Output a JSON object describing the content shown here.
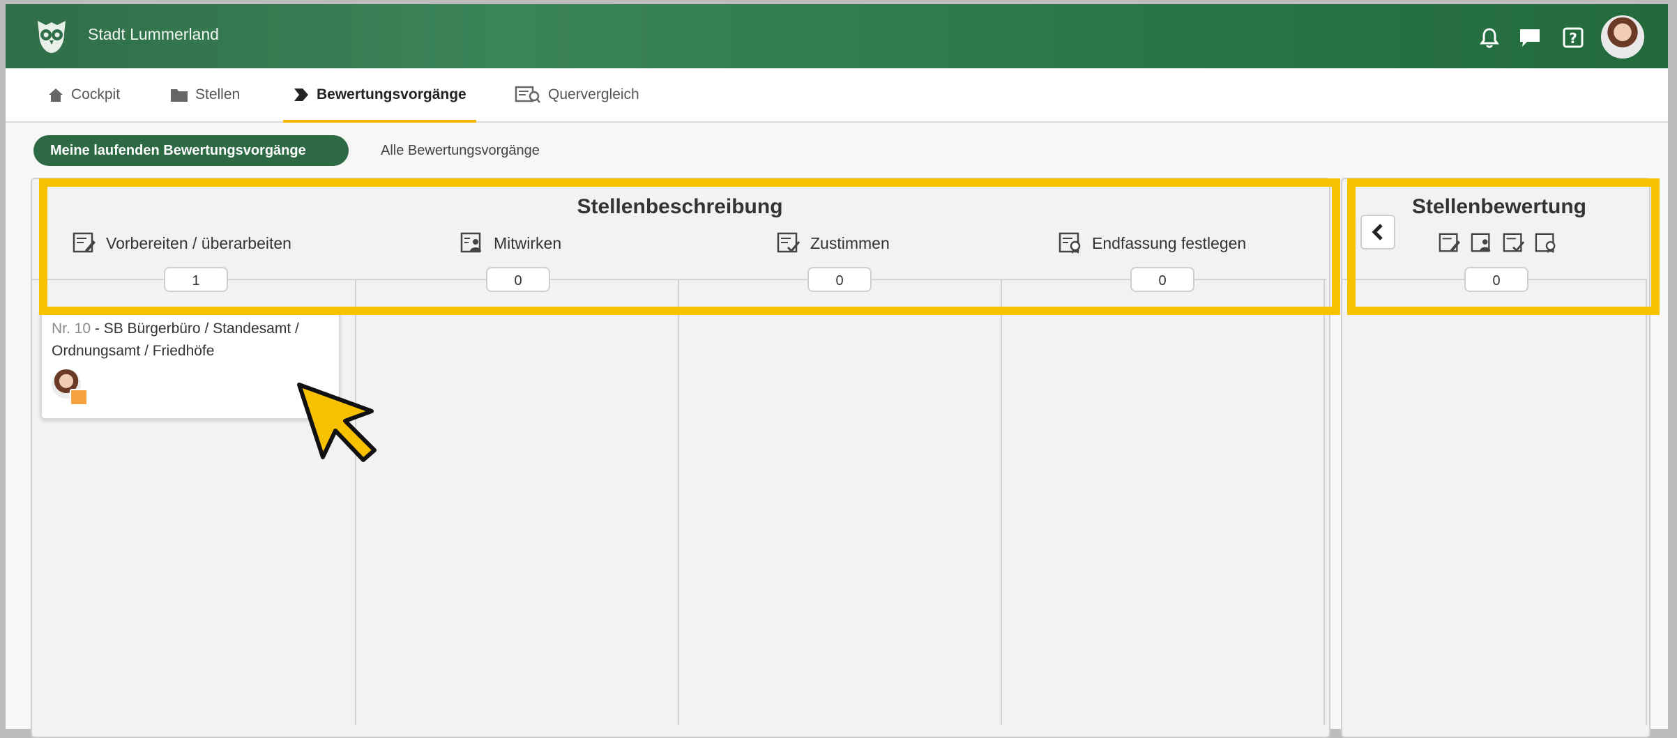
{
  "header": {
    "org_name": "Stadt Lummerland",
    "icons": [
      "owl-logo-icon",
      "bell-icon",
      "chat-icon",
      "help-icon",
      "user-avatar"
    ]
  },
  "tabs": [
    {
      "label": "Cockpit",
      "icon": "home-icon",
      "active": false
    },
    {
      "label": "Stellen",
      "icon": "folder-icon",
      "active": false
    },
    {
      "label": "Bewertungsvorgänge",
      "icon": "process-arrow-icon",
      "active": true
    },
    {
      "label": "Quervergleich",
      "icon": "compare-icon",
      "active": false
    }
  ],
  "filters": {
    "mine": "Meine laufenden Bewertungsvorgänge",
    "all": "Alle Bewertungsvorgänge"
  },
  "board": {
    "group1": {
      "title": "Stellenbeschreibung",
      "columns": [
        {
          "label": "Vorbereiten / überarbeiten",
          "count": "1"
        },
        {
          "label": "Mitwirken",
          "count": "0"
        },
        {
          "label": "Zustimmen",
          "count": "0"
        },
        {
          "label": "Endfassung festlegen",
          "count": "0"
        }
      ]
    },
    "group2": {
      "title": "Stellenbewertung",
      "count": "0"
    },
    "card": {
      "number": "Nr. 10",
      "title": " - SB Bürgerbüro / Standesamt / Ordnungsamt / Friedhöfe"
    }
  },
  "colors": {
    "header_green": "#2f6e48",
    "pill_green": "#2d6a44",
    "highlight_yellow": "#f8c100",
    "tab_underline": "#f4b400"
  }
}
